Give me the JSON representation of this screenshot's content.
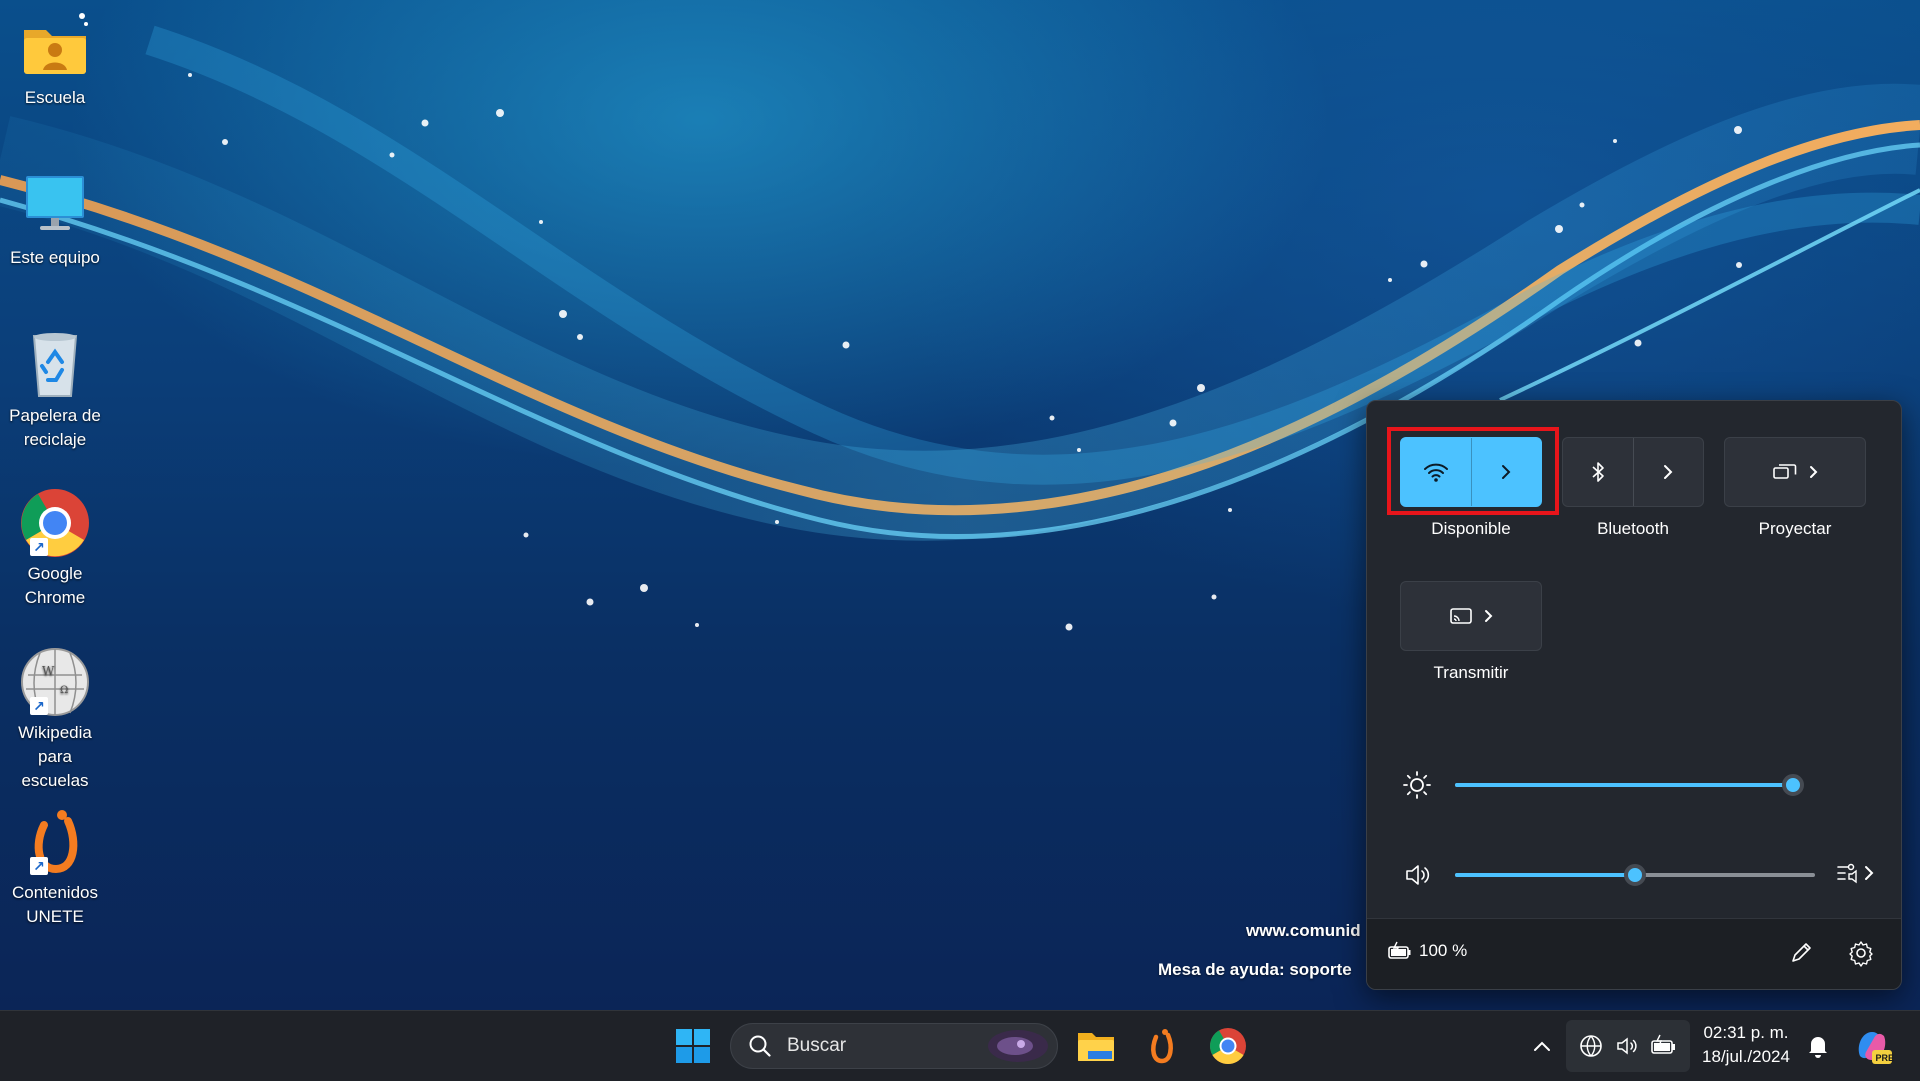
{
  "desktop": {
    "icons": [
      {
        "label_line1": "Escuela",
        "label_line2": "",
        "icon": "user-folder-icon",
        "shortcut": false
      },
      {
        "label_line1": "Este equipo",
        "label_line2": "",
        "icon": "monitor-icon",
        "shortcut": false
      },
      {
        "label_line1": "Papelera de",
        "label_line2": "reciclaje",
        "icon": "recycle-bin-icon",
        "shortcut": false
      },
      {
        "label_line1": "Google",
        "label_line2": "Chrome",
        "icon": "chrome-icon",
        "shortcut": true
      },
      {
        "label_line1": "Wikipedia",
        "label_line2": "para escuelas",
        "icon": "wikipedia-globe-icon",
        "shortcut": true
      },
      {
        "label_line1": "Contenidos",
        "label_line2": "UNETE",
        "icon": "unete-logo-icon",
        "shortcut": true
      }
    ],
    "watermark_line1": "www.comunid",
    "watermark_line2": "Mesa de ayuda: soporte"
  },
  "quick_settings": {
    "tiles": [
      {
        "label": "Disponible",
        "icon": "wifi-icon",
        "active": true,
        "has_chevron": true
      },
      {
        "label": "Bluetooth",
        "icon": "bluetooth-icon",
        "active": false,
        "has_chevron": true
      },
      {
        "label": "Proyectar",
        "icon": "project-display-icon",
        "active": false,
        "has_chevron": true
      },
      {
        "label": "Transmitir",
        "icon": "cast-icon",
        "active": false,
        "has_chevron": true
      }
    ],
    "brightness": {
      "icon": "brightness-sun-icon",
      "level": 0.97
    },
    "volume": {
      "icon": "speaker-volume-icon",
      "level": 0.5,
      "mixer_icon": "audio-mixer-icon"
    },
    "battery": {
      "icon": "battery-charging-icon",
      "text": "100 %"
    },
    "edit_icon": "pencil-edit-icon",
    "settings_icon": "gear-icon"
  },
  "taskbar": {
    "start_icon": "windows-start-icon",
    "search_placeholder": "Buscar",
    "apps": [
      "file-explorer-icon",
      "unete-app-icon",
      "chrome-icon"
    ],
    "tray": {
      "overflow_icon": "chevron-up-icon",
      "network_icon": "globe-network-icon",
      "volume_icon": "speaker-icon",
      "battery_icon": "battery-icon"
    },
    "clock_time": "02:31 p. m.",
    "clock_date": "18/jul./2024",
    "notification_icon": "bell-icon",
    "copilot_label": "PRE"
  },
  "colors": {
    "accent": "#4cc2ff",
    "highlight": "#e8151b",
    "panel": "#23272e",
    "taskbar": "#1f2228"
  }
}
